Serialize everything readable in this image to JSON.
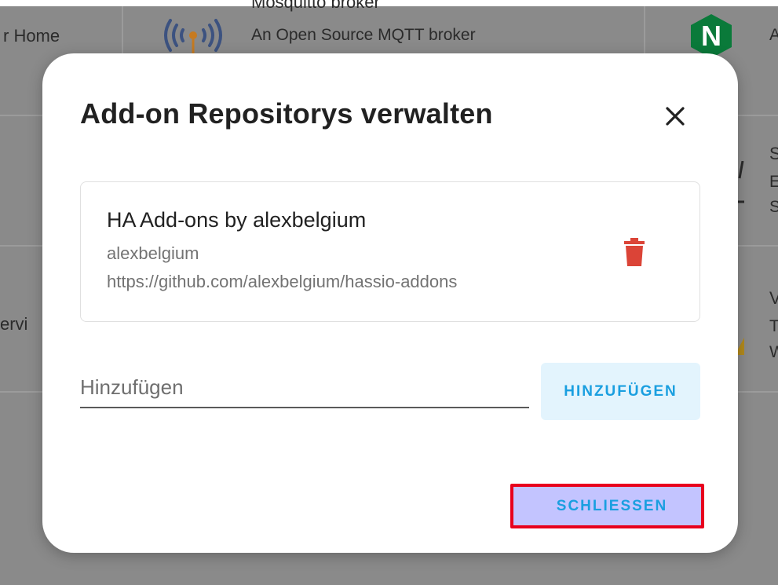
{
  "background": {
    "left_card_title_fragment": "r Home",
    "middle_card_title": "Mosquitto broker",
    "middle_card_description": "An Open Source MQTT broker",
    "right_card_letter": "A",
    "left_card_fragment_2": "ervi",
    "right_fragments": [
      "S",
      "E",
      "S",
      "V",
      "T",
      "W"
    ],
    "icons": [
      "mosquitto-broadcast-icon",
      "nginx-logo-icon",
      "warning-icon"
    ],
    "colors": {
      "nginx_green": "#0a7a3a",
      "mosquitto_blue": "#3c5280",
      "mosquitto_orange": "#c67a20"
    }
  },
  "dialog": {
    "title": "Add-on Repositorys verwalten",
    "close_icon": "close-icon",
    "repository": {
      "name": "HA Add-ons by alexbelgium",
      "owner": "alexbelgium",
      "url": "https://github.com/alexbelgium/hassio-addons",
      "delete_icon": "trash-icon",
      "delete_color": "#db4437"
    },
    "add_input": {
      "placeholder": "Hinzufügen",
      "value": ""
    },
    "add_button_label": "HINZUFÜGEN",
    "close_button_label": "SCHLIESSEN",
    "accent_color": "#1a9fe0"
  }
}
